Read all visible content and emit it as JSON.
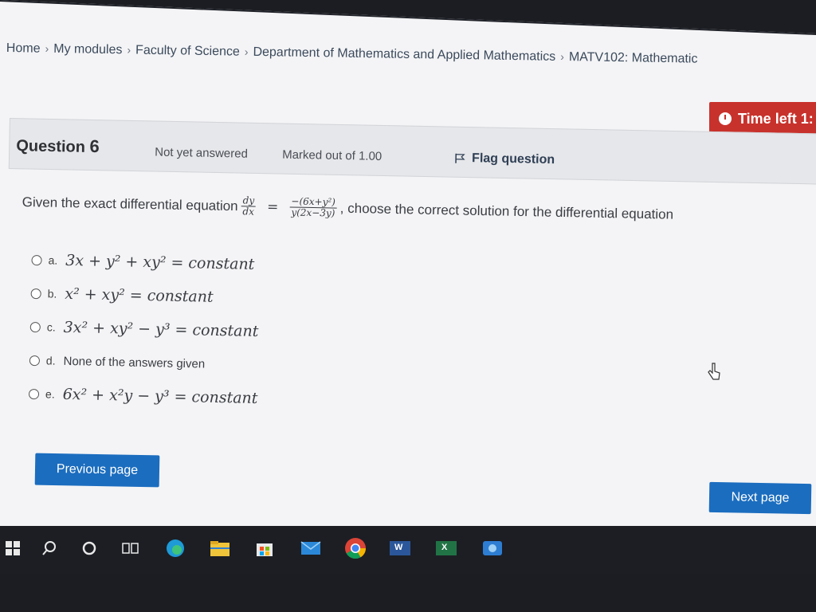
{
  "breadcrumb": {
    "items": [
      "Home",
      "My modules",
      "Faculty of Science",
      "Department of Mathematics and Applied Mathematics",
      "MATV102: Mathematic"
    ],
    "separator": "›"
  },
  "timer": {
    "label": "Time left 1:"
  },
  "question": {
    "label": "Question",
    "number": "6",
    "status": "Not yet answered",
    "marks": "Marked out of 1.00",
    "flag_label": "Flag question",
    "text_before": "Given the exact differential equation",
    "lhs_num": "dy",
    "lhs_den": "dx",
    "eq_sign": "=",
    "rhs_num": "−(6x+y²)",
    "rhs_den": "y(2x−3y)",
    "text_after": ", choose the correct solution for the differential equation"
  },
  "answers": [
    {
      "letter": "a.",
      "text": "3x + y² + xy² = constant",
      "is_math": true
    },
    {
      "letter": "b.",
      "text": "x² + xy² = constant",
      "is_math": true
    },
    {
      "letter": "c.",
      "text": "3x² + xy² − y³ = constant",
      "is_math": true
    },
    {
      "letter": "d.",
      "text": "None of the answers given",
      "is_math": false
    },
    {
      "letter": "e.",
      "text": "6x² + x²y − y³ = constant",
      "is_math": true
    }
  ],
  "nav": {
    "prev_label": "Previous page",
    "next_label": "Next page"
  },
  "taskbar": {
    "icons": [
      "windows-start-icon",
      "search-icon",
      "cortana-icon",
      "task-view-icon",
      "edge-icon",
      "file-explorer-icon",
      "store-icon",
      "mail-icon",
      "chrome-icon",
      "word-icon",
      "excel-icon",
      "app-icon"
    ],
    "word_label": "W",
    "excel_label": "X"
  },
  "colors": {
    "accent": "#1b6dbf",
    "timer": "#c8322c"
  }
}
